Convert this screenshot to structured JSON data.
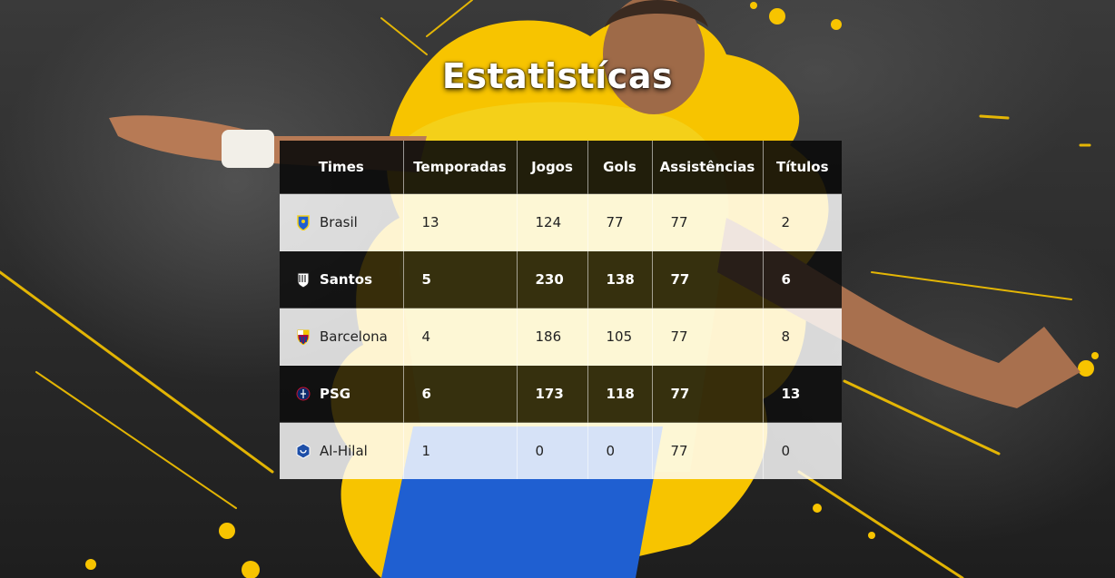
{
  "page": {
    "title": "Estatistícas"
  },
  "table": {
    "headers": [
      "Times",
      "Temporadas",
      "Jogos",
      "Gols",
      "Assistências",
      "Títulos"
    ],
    "rows": [
      {
        "team": "Brasil",
        "crest": "brasil-crest-icon",
        "seasons": "13",
        "games": "124",
        "goals": "77",
        "assists": "77",
        "titles": "2",
        "style": "light"
      },
      {
        "team": "Santos",
        "crest": "santos-crest-icon",
        "seasons": "5",
        "games": "230",
        "goals": "138",
        "assists": "77",
        "titles": "6",
        "style": "dark"
      },
      {
        "team": "Barcelona",
        "crest": "barcelona-crest-icon",
        "seasons": "4",
        "games": "186",
        "goals": "105",
        "assists": "77",
        "titles": "8",
        "style": "light"
      },
      {
        "team": "PSG",
        "crest": "psg-crest-icon",
        "seasons": "6",
        "games": "173",
        "goals": "118",
        "assists": "77",
        "titles": "13",
        "style": "dark"
      },
      {
        "team": "Al-Hilal",
        "crest": "al-hilal-crest-icon",
        "seasons": "1",
        "games": "0",
        "goals": "0",
        "assists": "77",
        "titles": "0",
        "style": "light"
      }
    ]
  },
  "colors": {
    "accent_yellow": "#f7c400",
    "jersey_blue": "#1f5fd1",
    "jersey_yellow": "#f3d11a"
  }
}
